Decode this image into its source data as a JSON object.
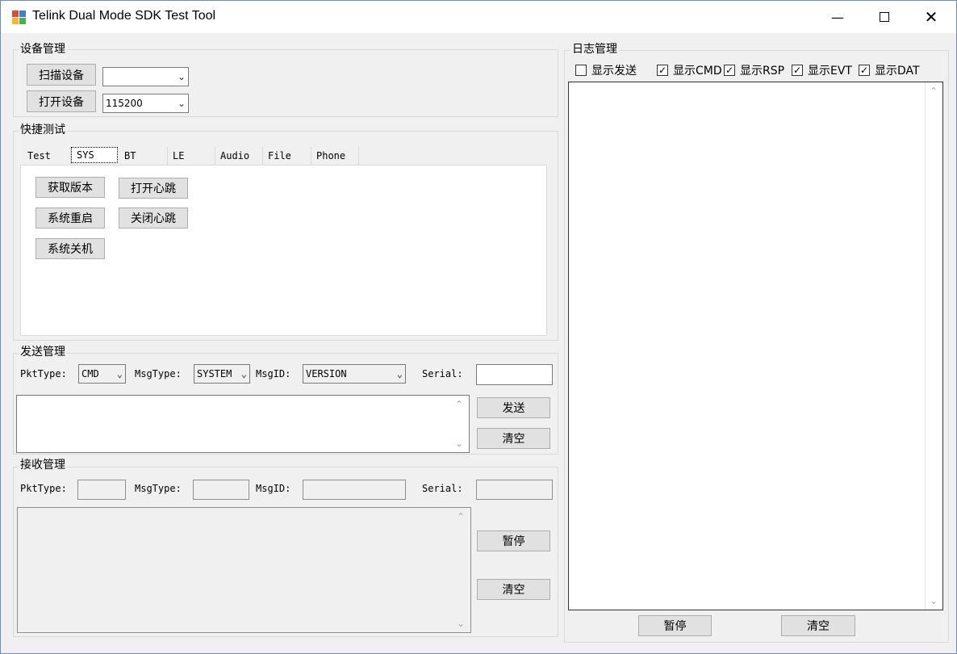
{
  "window": {
    "title": "Telink Dual Mode SDK Test Tool"
  },
  "device": {
    "group_label": "设备管理",
    "scan_button": "扫描设备",
    "device_select": "",
    "open_button": "打开设备",
    "baud_select": "115200"
  },
  "quick": {
    "group_label": "快捷测试",
    "tabs": [
      "Test",
      "SYS",
      "BT",
      "LE",
      "Audio",
      "File",
      "Phone"
    ],
    "active_tab": "SYS",
    "buttons": {
      "get_version": "获取版本",
      "open_heartbeat": "打开心跳",
      "reboot": "系统重启",
      "close_heartbeat": "关闭心跳",
      "shutdown": "系统关机"
    }
  },
  "send": {
    "group_label": "发送管理",
    "pkt_type_label": "PktType:",
    "pkt_type_value": "CMD",
    "msg_type_label": "MsgType:",
    "msg_type_value": "SYSTEM",
    "msg_id_label": "MsgID:",
    "msg_id_value": "VERSION",
    "serial_label": "Serial:",
    "serial_value": "",
    "send_button": "发送",
    "clear_button": "清空"
  },
  "recv": {
    "group_label": "接收管理",
    "pkt_type_label": "PktType:",
    "msg_type_label": "MsgType:",
    "msg_id_label": "MsgID:",
    "serial_label": "Serial:",
    "pause_button": "暂停",
    "clear_button": "清空"
  },
  "log": {
    "group_label": "日志管理",
    "checkboxes": [
      {
        "label": "显示发送",
        "checked": false
      },
      {
        "label": "显示CMD",
        "checked": true
      },
      {
        "label": "显示RSP",
        "checked": true
      },
      {
        "label": "显示EVT",
        "checked": true
      },
      {
        "label": "显示DAT",
        "checked": true
      }
    ],
    "pause_button": "暂停",
    "clear_button": "清空"
  },
  "icons": [
    "app-icon",
    "minimize-icon",
    "maximize-icon",
    "close-icon",
    "chevron-down-icon",
    "scroll-up-icon",
    "scroll-down-icon",
    "checkmark-icon"
  ]
}
